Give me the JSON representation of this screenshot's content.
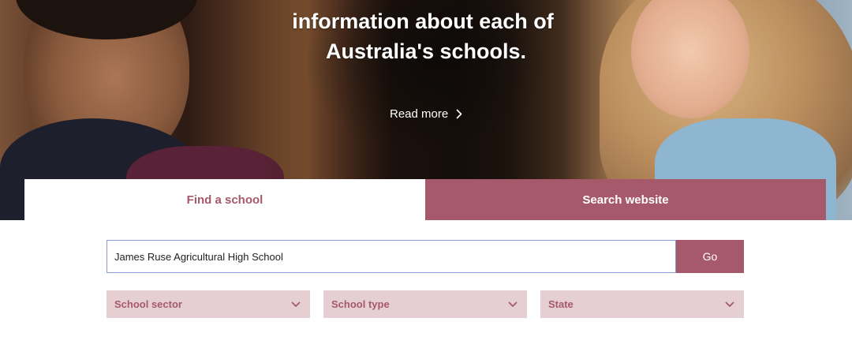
{
  "hero": {
    "lines": [
      "",
      "information about each of",
      "Australia's schools."
    ],
    "read_more_label": "Read more"
  },
  "tabs": [
    {
      "label": "Find a school",
      "active": true
    },
    {
      "label": "Search website",
      "active": false
    }
  ],
  "search": {
    "value": "James Ruse Agricultural High School",
    "placeholder": "",
    "go_label": "Go"
  },
  "filters": [
    {
      "label": "School sector",
      "icon": "chevron-down-icon"
    },
    {
      "label": "School type",
      "icon": "chevron-down-icon"
    },
    {
      "label": "State",
      "icon": "chevron-down-icon"
    }
  ],
  "colors": {
    "accent": "#a6596a",
    "filter_bg": "#e6cfd3",
    "input_border": "#8a9ad8"
  }
}
